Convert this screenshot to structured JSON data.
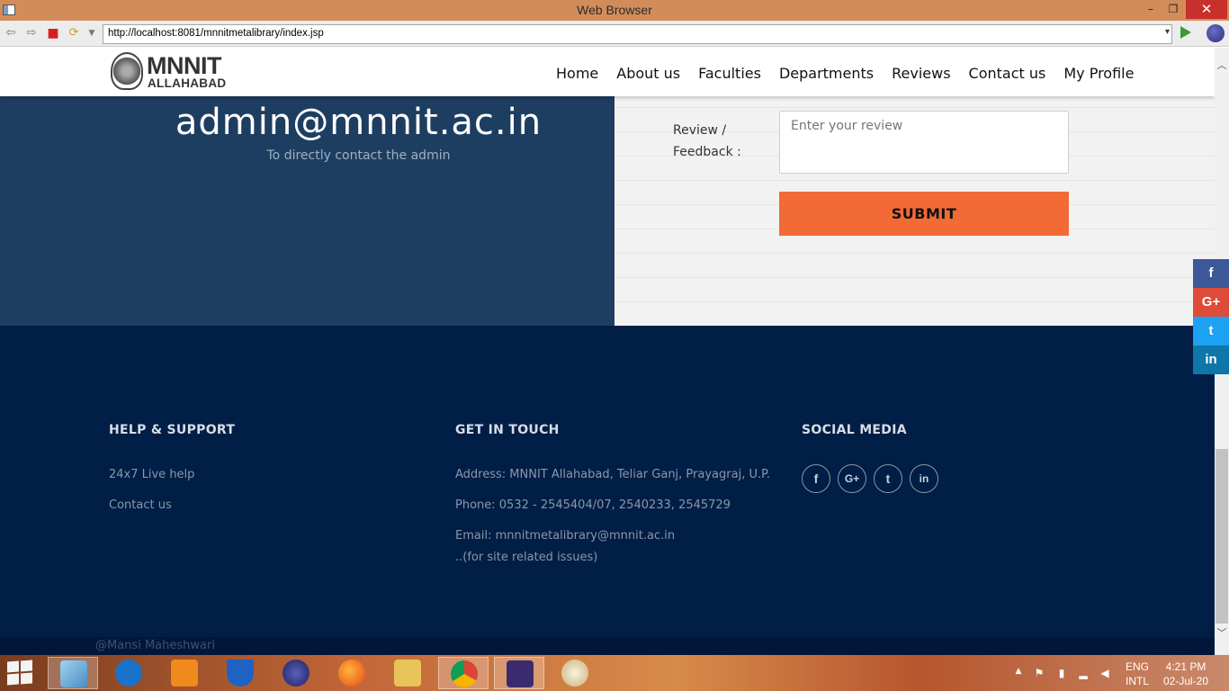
{
  "window": {
    "title": "Web Browser",
    "minimize": "–",
    "restore": "❐",
    "close": "✕"
  },
  "browser": {
    "url": "http://localhost:8081/mnnitmetalibrary/index.jsp"
  },
  "site": {
    "logo_main": "MNNIT",
    "logo_sub": "ALLAHABAD",
    "nav": [
      "Home",
      "About us",
      "Faculties",
      "Departments",
      "Reviews",
      "Contact us",
      "My Profile"
    ]
  },
  "contact": {
    "email": "admin@mnnit.ac.in",
    "caption": "To directly contact the admin"
  },
  "review_form": {
    "label": "Review / Feedback :",
    "placeholder": "Enter your review",
    "submit": "SUBMIT"
  },
  "footer": {
    "help": {
      "heading": "HELP & SUPPORT",
      "links": [
        "24x7 Live help",
        "Contact us"
      ]
    },
    "touch": {
      "heading": "GET IN TOUCH",
      "address": "Address: MNNIT Allahabad, Teliar Ganj, Prayagraj, U.P.",
      "phone": "Phone: 0532 - 2545404/07, 2540233, 2545729",
      "email": "Email: mnnitmetalibrary@mnnit.ac.in",
      "note": "..(for site related issues)"
    },
    "social": {
      "heading": "SOCIAL MEDIA",
      "icons": [
        "f",
        "G+",
        "t",
        "in"
      ]
    },
    "copyright": "@Mansi Maheshwari"
  },
  "float_social": [
    {
      "icon": "f",
      "color": "#3b5998"
    },
    {
      "icon": "G+",
      "color": "#dd4b39"
    },
    {
      "icon": "t",
      "color": "#1da1f2"
    },
    {
      "icon": "in",
      "color": "#0e76a8"
    }
  ],
  "taskbar": {
    "lang_top": "ENG",
    "lang_bottom": "INTL",
    "time": "4:21 PM",
    "date": "02-Jul-20"
  }
}
